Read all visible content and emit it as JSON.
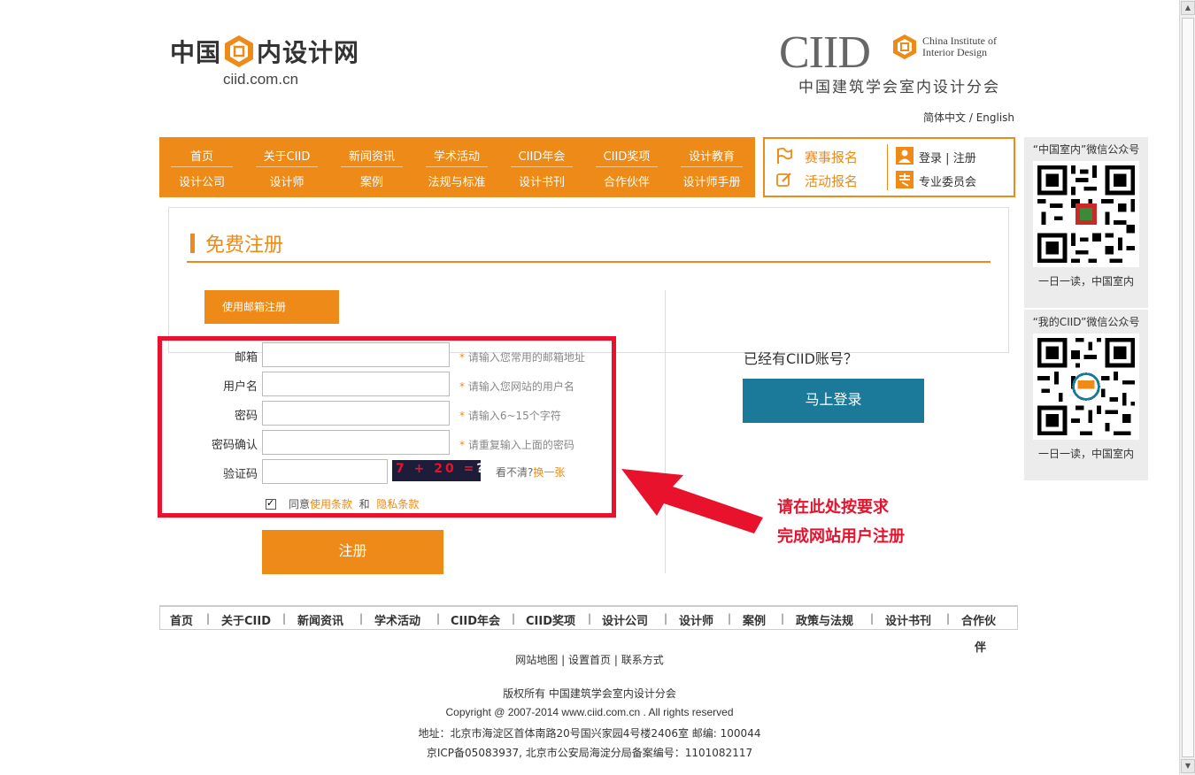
{
  "logo_left": {
    "cn_left": "中国",
    "cn_right": "内设计网",
    "domain": "ciid.com.cn"
  },
  "logo_right": {
    "big": "CIID",
    "en_line1": "China Institute of",
    "en_line2": "Interior Design",
    "cn": "中国建筑学会室内设计分会"
  },
  "lang": {
    "cn": "简体中文",
    "sep": " /",
    "en": "English"
  },
  "nav": {
    "row1": [
      "首页",
      "关于CIID",
      "新闻资讯",
      "学术活动",
      "CIID年会",
      "CIID奖项",
      "设计教育"
    ],
    "row2": [
      "设计公司",
      "设计师",
      "案例",
      "法规与标准",
      "设计书刊",
      "合作伙伴",
      "设计师手册"
    ]
  },
  "quick": {
    "contest": "赛事报名",
    "event": "活动报名",
    "login": "登录",
    "divider": "|",
    "register": "注册",
    "committee": "专业委员会"
  },
  "qr": [
    {
      "title": "“中国室内”微信公众号",
      "sub": "一日一读，中国室内"
    },
    {
      "title": "“我的CIID”微信公众号",
      "sub": "一日一读，中国室内"
    }
  ],
  "page": {
    "title": "免费注册",
    "email_tab": "使用邮箱注册"
  },
  "form": {
    "fields": [
      {
        "label": "邮箱",
        "hint": "请输入您常用的邮箱地址"
      },
      {
        "label": "用户名",
        "hint": "请输入您网站的用户名"
      },
      {
        "label": "密码",
        "hint": "请输入6~15个字符"
      },
      {
        "label": "密码确认",
        "hint": "请重复输入上面的密码"
      },
      {
        "label": "验证码"
      }
    ],
    "star": "*",
    "captcha": "7 + 20 =",
    "captcha_q": "?",
    "refresh_prefix": "看不清?",
    "refresh_link": "换一张",
    "agree_prefix": "同意",
    "terms": "使用条款",
    "and": "和",
    "privacy": "隐私条款",
    "submit": "注册"
  },
  "login": {
    "prompt": "已经有CIID账号？",
    "button": "马上登录"
  },
  "annotation": {
    "line1": "请在此处按要求",
    "line2": "完成网站用户注册"
  },
  "footer": {
    "nav": [
      "首页",
      "关于CIID",
      "新闻资讯",
      "学术活动",
      "CIID年会",
      "CIID奖项",
      "设计公司",
      "设计师",
      "案例",
      "政策与法规",
      "设计书刊",
      "合作伙"
    ],
    "nav_wrap": "伴",
    "sep": "|",
    "links": [
      "网站地图",
      "设置首页",
      "联系方式"
    ],
    "copyright_cn": "版权所有  中国建筑学会室内设计分会",
    "copyright_en": "Copyright @ 2007-2014 www.ciid.com.cn . All rights reserved",
    "address": "地址：北京市海淀区首体南路20号国兴家园4号楼2406室  邮编: 100044",
    "icp": "京ICP备05083937, 北京市公安局海淀分局备案编号：1101082117"
  },
  "colors": {
    "accent": "#ee8a17",
    "login": "#1b7a99",
    "annotation": "#e8122d"
  }
}
